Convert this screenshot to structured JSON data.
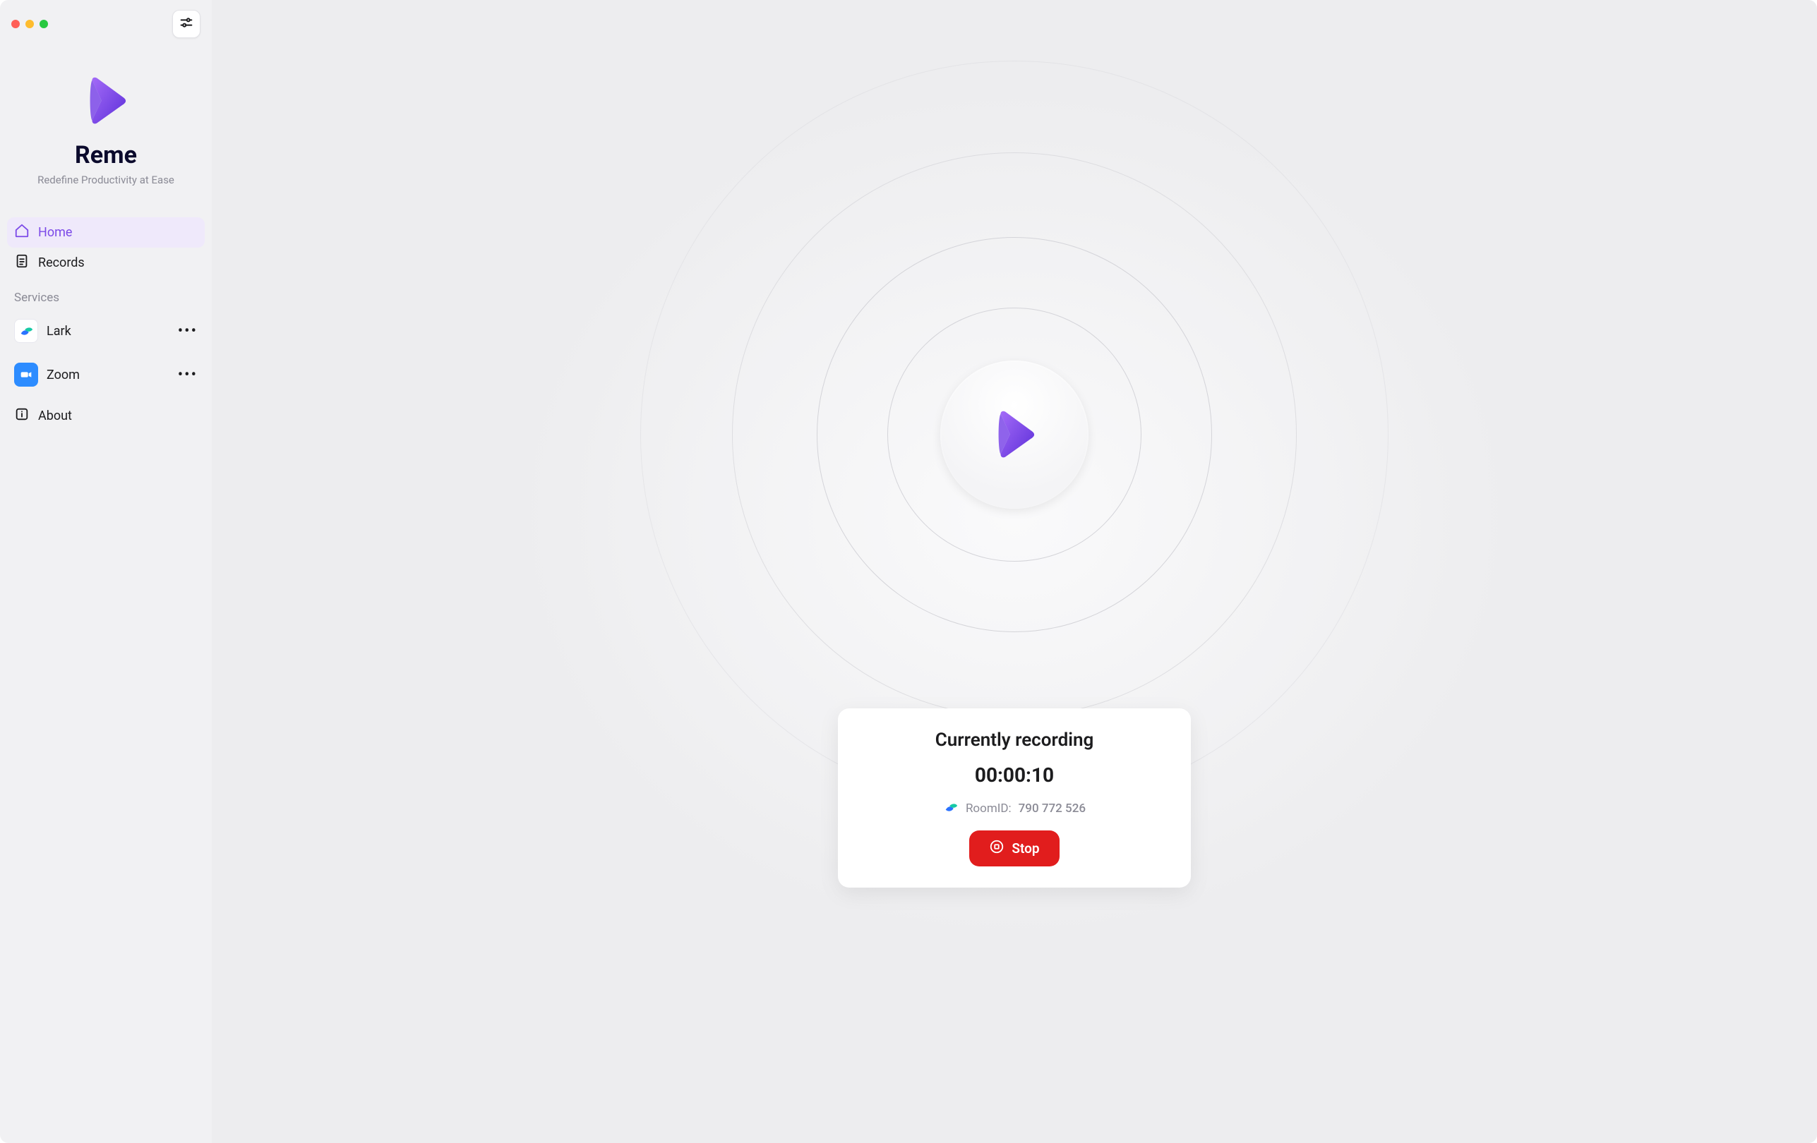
{
  "app": {
    "title": "Reme",
    "tagline": "Redefine Productivity at Ease"
  },
  "sidebar": {
    "nav": [
      {
        "icon": "home",
        "label": "Home",
        "active": true
      },
      {
        "icon": "file",
        "label": "Records",
        "active": false
      }
    ],
    "services_label": "Services",
    "services": [
      {
        "icon": "lark",
        "label": "Lark"
      },
      {
        "icon": "zoom",
        "label": "Zoom"
      }
    ],
    "about_label": "About"
  },
  "recording_card": {
    "title": "Currently recording",
    "timer": "00:00:10",
    "room_label": "RoomID:",
    "room_value": "790 772 526",
    "stop_label": "Stop"
  }
}
